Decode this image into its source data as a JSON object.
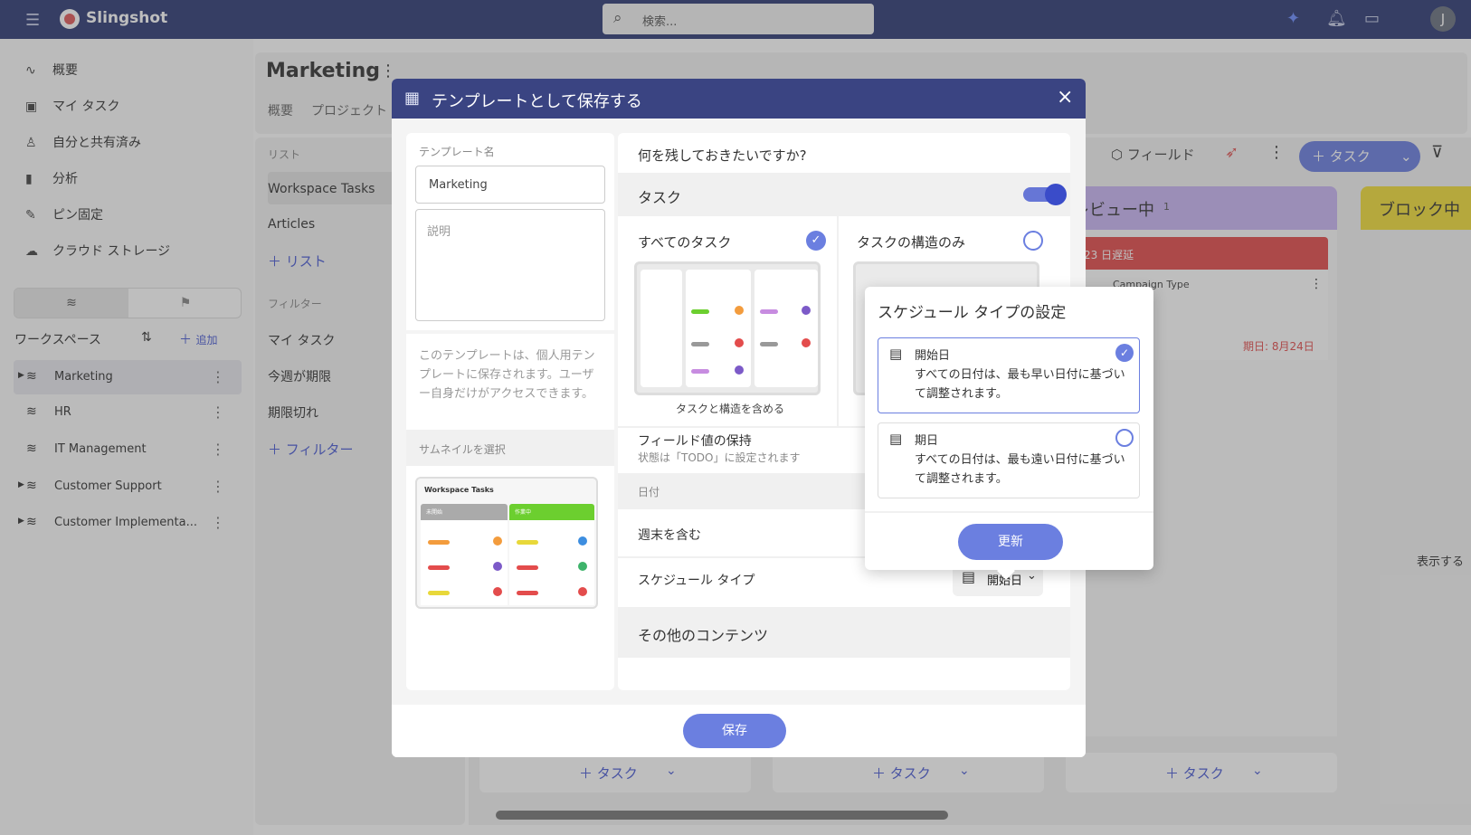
{
  "topbar": {
    "brand": "Slingshot",
    "search_placeholder": "検索..."
  },
  "sidebar": {
    "nav": [
      {
        "label": "概要",
        "icon": "activity-icon"
      },
      {
        "label": "マイ タスク",
        "icon": "clipboard-icon"
      },
      {
        "label": "自分と共有済み",
        "icon": "user-share-icon"
      },
      {
        "label": "分析",
        "icon": "bar-chart-icon"
      },
      {
        "label": "ピン固定",
        "icon": "pin-icon"
      },
      {
        "label": "クラウド ストレージ",
        "icon": "cloud-icon"
      }
    ],
    "workspace_title": "ワークスペース",
    "add_label": "追加",
    "workspaces": [
      {
        "label": "Marketing"
      },
      {
        "label": "HR"
      },
      {
        "label": "IT Management"
      },
      {
        "label": "Customer Support"
      },
      {
        "label": "Customer Implementa..."
      }
    ]
  },
  "main": {
    "title": "Marketing",
    "tabs": [
      "概要",
      "プロジェクト"
    ],
    "list_section": "リスト",
    "lists": [
      "Workspace Tasks",
      "Articles"
    ],
    "add_list": "リスト",
    "filter_section": "フィルター",
    "filters": [
      "マイ タスク",
      "今週が期限",
      "期限切れ"
    ],
    "add_filter": "フィルター"
  },
  "board": {
    "fields_label": "フィールド",
    "task_button": "タスク",
    "review_col": "レビュー中",
    "review_count": "1",
    "blocked_col": "ブロック中",
    "late_badge": "23 日遅延",
    "card_tag": "Campaign Type",
    "due_label": "期日: 8月24日",
    "show_label": "表示する",
    "add_task": "タスク"
  },
  "modal": {
    "title": "テンプレートとして保存する",
    "template_name_label": "テンプレート名",
    "template_name_value": "Marketing",
    "description_placeholder": "説明",
    "info": "このテンプレートは、個人用テンプレートに保存されます。ユーザー自身だけがアクセスできます。",
    "thumbnail_label": "サムネイルを選択",
    "thumb_title": "Workspace Tasks",
    "thumb_col1": "未開始",
    "thumb_col2": "作業中",
    "question": "何を残しておきたいですか?",
    "tasks_label": "タスク",
    "all_tasks": "すべてのタスク",
    "structure_only": "タスクの構造のみ",
    "all_tasks_caption": "タスクと構造を含める",
    "keep_fields": "フィールド値の保持",
    "keep_fields_sub": "状態は「TODO」に設定されます",
    "dates_section": "日付",
    "include_weekends": "週末を含む",
    "schedule_type": "スケジュール タイプ",
    "schedule_value": "開始日",
    "other_content": "その他のコンテンツ",
    "save": "保存"
  },
  "popover": {
    "title": "スケジュール タイプの設定",
    "options": [
      {
        "label": "開始日",
        "desc": "すべての日付は、最も早い日付に基づいて調整されます。"
      },
      {
        "label": "期日",
        "desc": "すべての日付は、最も遠い日付に基づいて調整されます。"
      }
    ],
    "update": "更新"
  }
}
